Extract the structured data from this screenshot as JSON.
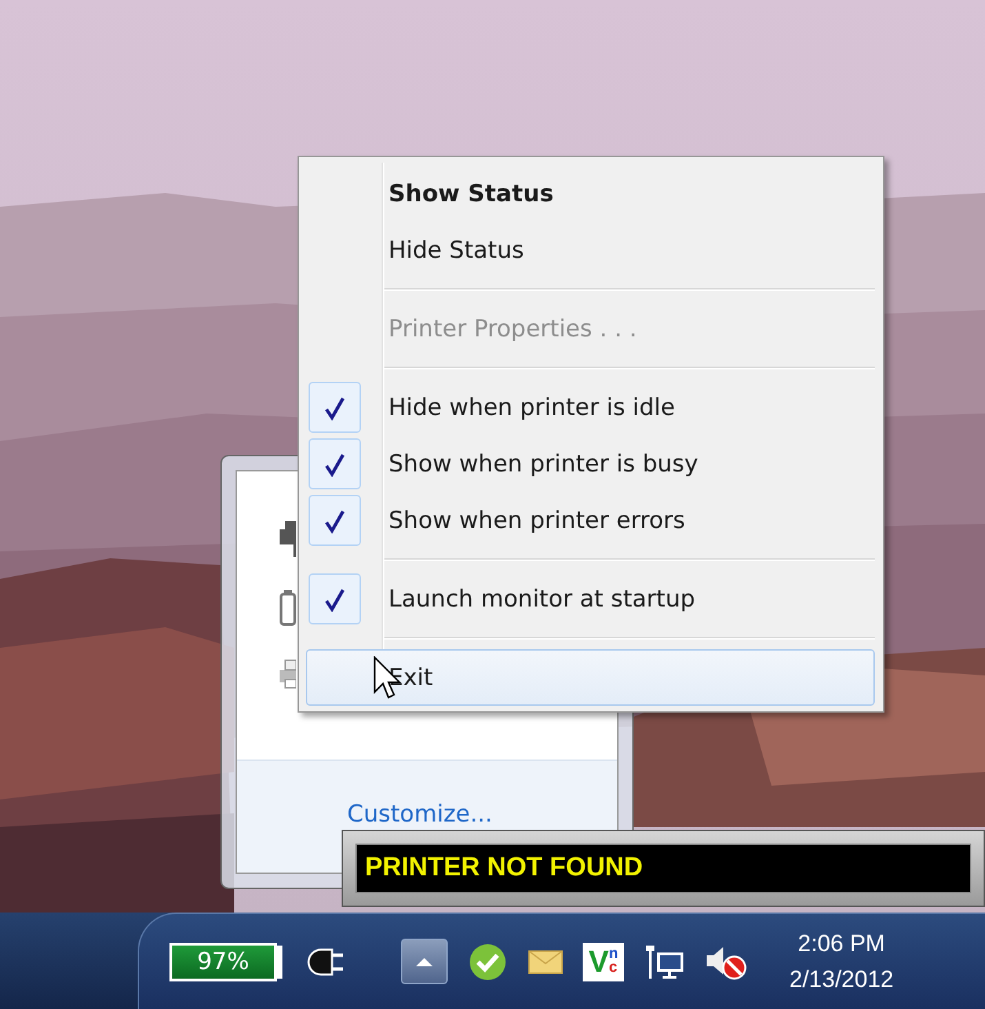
{
  "menu": {
    "items": [
      {
        "kind": "command",
        "label": "Show Status",
        "default": true,
        "disabled": false,
        "selected": false
      },
      {
        "kind": "command",
        "label": "Hide Status",
        "default": false,
        "disabled": false,
        "selected": false
      },
      {
        "kind": "separator"
      },
      {
        "kind": "command",
        "label": "Printer Properties . . .",
        "default": false,
        "disabled": true,
        "selected": false
      },
      {
        "kind": "separator"
      },
      {
        "kind": "check",
        "label": "Hide when printer is idle",
        "checked": true,
        "selected": false
      },
      {
        "kind": "check",
        "label": "Show when printer is busy",
        "checked": true,
        "selected": false
      },
      {
        "kind": "check",
        "label": "Show when printer errors",
        "checked": true,
        "selected": false
      },
      {
        "kind": "separator"
      },
      {
        "kind": "check",
        "label": "Launch monitor at startup",
        "checked": true,
        "selected": false
      },
      {
        "kind": "separator"
      },
      {
        "kind": "command",
        "label": "Exit",
        "default": false,
        "disabled": false,
        "selected": true
      }
    ]
  },
  "overflow_panel": {
    "link": "Customize..."
  },
  "notification": {
    "text": "PRINTER NOT FOUND"
  },
  "taskbar": {
    "battery": {
      "text": "97%"
    },
    "tray_icons": [
      {
        "kind": "power"
      },
      {
        "kind": "show-hidden"
      },
      {
        "kind": "chat"
      },
      {
        "kind": "mail"
      },
      {
        "kind": "vnc",
        "text_1": "V",
        "text_2": "n",
        "text_3": "c"
      },
      {
        "kind": "network"
      },
      {
        "kind": "volume-muted"
      }
    ],
    "clock": {
      "time": "2:06 PM",
      "date": "2/13/2012"
    }
  }
}
